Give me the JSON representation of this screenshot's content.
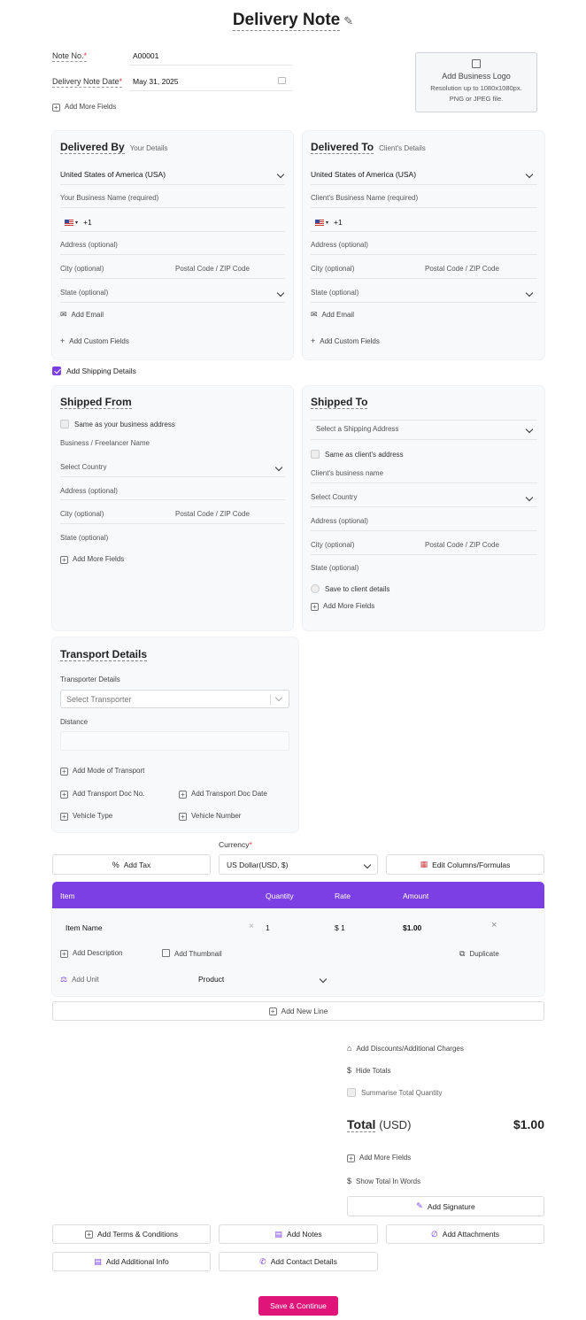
{
  "header": {
    "title": "Delivery Note",
    "edit_icon": "pencil-icon"
  },
  "meta": {
    "note_no_label": "Note No.",
    "note_no_value": "A00001",
    "date_label": "Delivery Note Date",
    "date_value": "May 31, 2025",
    "add_more_fields": "Add More Fields",
    "required_mark": "*"
  },
  "logo": {
    "title": "Add Business Logo",
    "hint_line1": "Resolution up to 1080x1080px.",
    "hint_line2": "PNG or JPEG file."
  },
  "delivered_by": {
    "title": "Delivered By",
    "subtitle": "Your Details",
    "country": "United States of America (USA)",
    "business_name": "Your Business Name (required)",
    "phone_code": "+1",
    "address": "Address (optional)",
    "city": "City (optional)",
    "postal": "Postal Code / ZIP Code",
    "state": "State (optional)",
    "add_email": "Add Email",
    "add_custom": "Add Custom Fields"
  },
  "delivered_to": {
    "title": "Delivered To",
    "subtitle": "Client's Details",
    "country": "United States of America (USA)",
    "business_name": "Client's Business Name (required)",
    "phone_code": "+1",
    "address": "Address (optional)",
    "city": "City (optional)",
    "postal": "Postal Code / ZIP Code",
    "state": "State (optional)",
    "add_email": "Add Email",
    "add_custom": "Add Custom Fields"
  },
  "shipping_toggle": {
    "label": "Add Shipping Details",
    "checked": true
  },
  "shipped_from": {
    "title": "Shipped From",
    "same_as": "Same as your business address",
    "business": "Business / Freelancer Name",
    "country": "Select Country",
    "address": "Address (optional)",
    "city": "City (optional)",
    "postal": "Postal Code / ZIP Code",
    "state": "State (optional)",
    "add_more": "Add More Fields"
  },
  "shipped_to": {
    "title": "Shipped To",
    "select_address": "Select a Shipping Address",
    "same_as": "Same as client's address",
    "business": "Client's business name",
    "country": "Select Country",
    "address": "Address (optional)",
    "city": "City (optional)",
    "postal": "Postal Code / ZIP Code",
    "state": "State (optional)",
    "save_client": "Save to client details",
    "add_more": "Add More Fields"
  },
  "transport": {
    "title": "Transport Details",
    "transporter_label": "Transporter Details",
    "transporter_placeholder": "Select Transporter",
    "distance_label": "Distance",
    "add_mode": "Add Mode of Transport",
    "add_doc_no": "Add Transport Doc No.",
    "add_doc_date": "Add Transport Doc Date",
    "vehicle_type": "Vehicle Type",
    "vehicle_number": "Vehicle Number"
  },
  "currency": {
    "label": "Currency",
    "value": "US Dollar(USD, $)",
    "add_tax": "Add Tax",
    "edit_columns": "Edit Columns/Formulas"
  },
  "table": {
    "headers": [
      "Item",
      "Quantity",
      "Rate",
      "Amount"
    ],
    "row": {
      "item": "Item Name",
      "quantity": "1",
      "rate": "$ 1",
      "amount": "$1.00",
      "add_description": "Add Description",
      "add_thumbnail": "Add Thumbnail",
      "duplicate": "Duplicate",
      "add_unit": "Add Unit",
      "unit_value": "Product"
    },
    "add_new_line": "Add New Line"
  },
  "totals": {
    "discounts": "Add Discounts/Additional Charges",
    "hide_totals": "Hide Totals",
    "summarise": "Summarise Total Quantity",
    "total_label": "Total",
    "total_currency": "(USD)",
    "total_value": "$1.00",
    "add_more": "Add More Fields",
    "words": "Show Total In Words",
    "signature": "Add Signature"
  },
  "footer": {
    "terms": "Add Terms & Conditions",
    "notes": "Add Notes",
    "attachments": "Add Attachments",
    "additional": "Add Additional Info",
    "contact": "Add Contact Details",
    "save": "Save & Continue"
  },
  "colors": {
    "accent": "#7b3fe4",
    "save": "#e0157a"
  }
}
